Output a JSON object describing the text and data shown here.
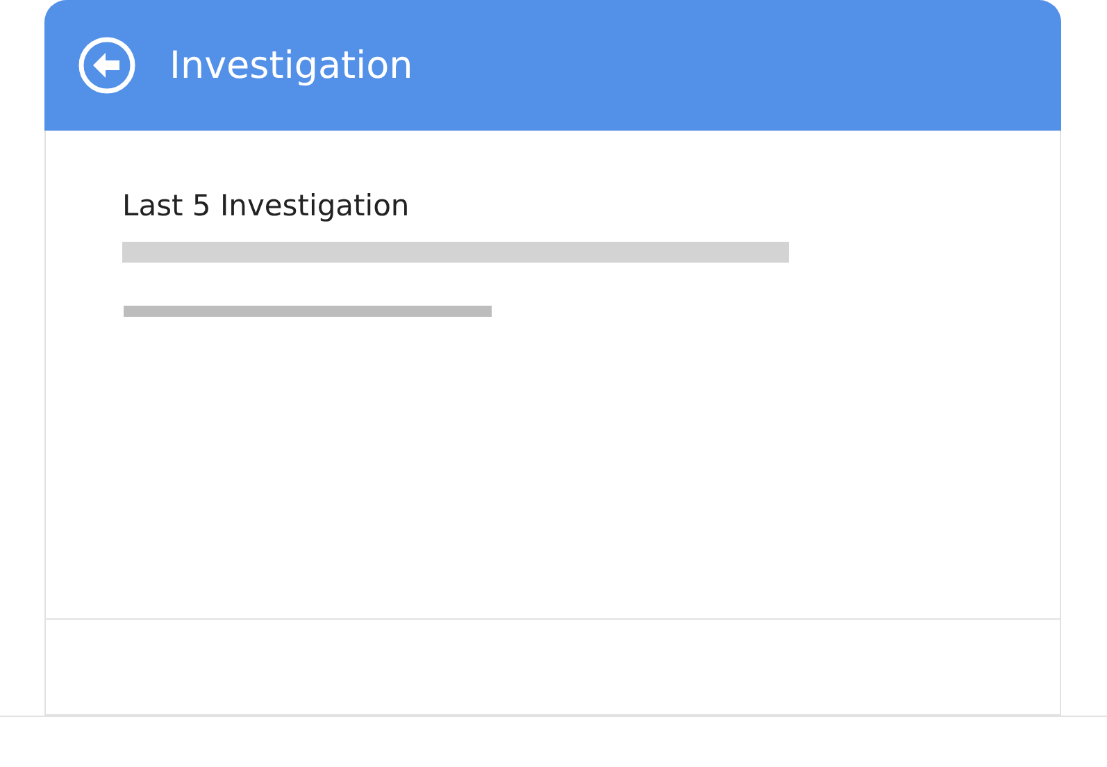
{
  "header": {
    "title": "Investigation"
  },
  "section": {
    "heading": "Last 5 Investigation"
  }
}
